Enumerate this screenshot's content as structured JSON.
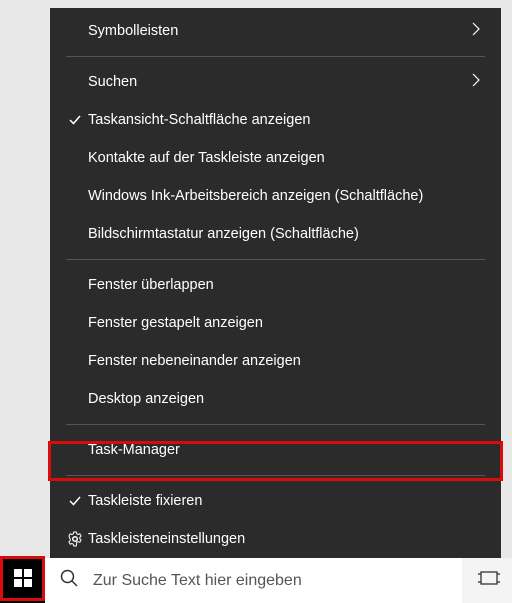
{
  "menu": {
    "section1": {
      "symbolleisten": "Symbolleisten",
      "suchen": "Suchen",
      "taskansicht": "Taskansicht-Schaltfläche anzeigen",
      "kontakte": "Kontakte auf der Taskleiste anzeigen",
      "windows_ink": "Windows Ink-Arbeitsbereich anzeigen (Schaltfläche)",
      "bildschirmtastatur": "Bildschirmtastatur anzeigen (Schaltfläche)"
    },
    "section2": {
      "fenster_ueberlappen": "Fenster überlappen",
      "fenster_gestapelt": "Fenster gestapelt anzeigen",
      "fenster_nebeneinander": "Fenster nebeneinander anzeigen",
      "desktop_anzeigen": "Desktop anzeigen"
    },
    "section3": {
      "task_manager": "Task-Manager"
    },
    "section4": {
      "taskleiste_fixieren": "Taskleiste fixieren",
      "taskleisteneinstellungen": "Taskleisteneinstellungen"
    }
  },
  "taskbar": {
    "search_placeholder": "Zur Suche Text hier eingeben"
  }
}
